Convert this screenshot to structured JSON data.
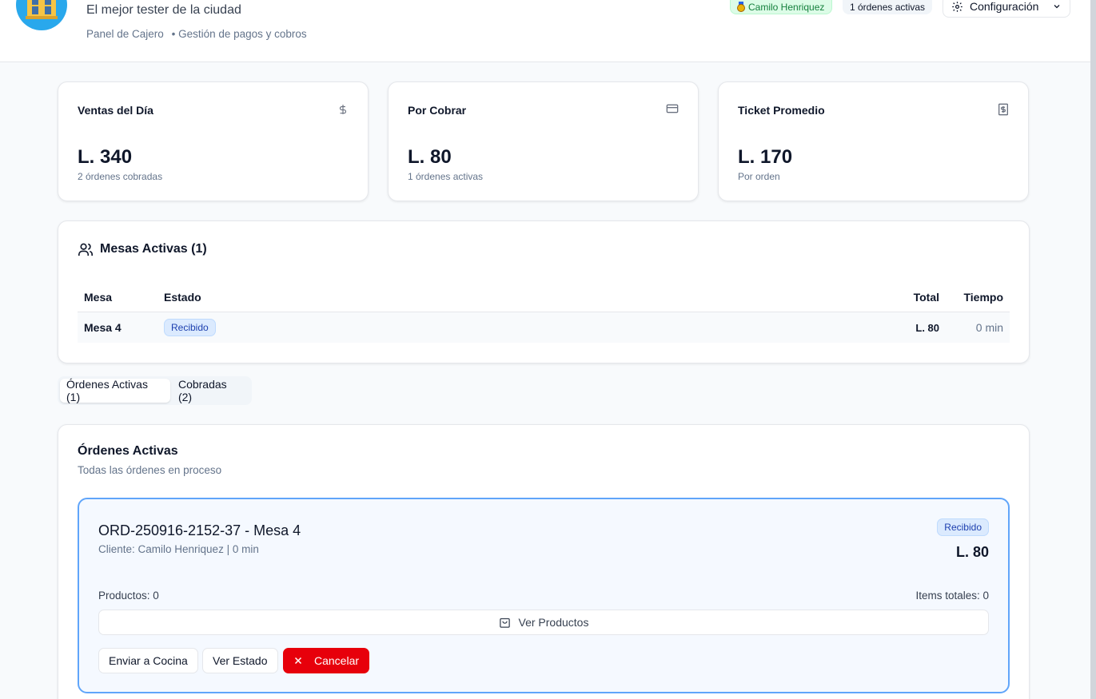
{
  "header": {
    "subtitle": "El mejor tester de la ciudad",
    "panel_label": "Panel de Cajero",
    "panel_desc": "• Gestión de pagos y cobros",
    "user_badge": "Camilo Henriquez",
    "active_badge": "1 órdenes activas",
    "config_label": "Configuración"
  },
  "stats": [
    {
      "title": "Ventas del Día",
      "value": "L. 340",
      "sub": "2 órdenes cobradas",
      "icon": "dollar-icon"
    },
    {
      "title": "Por Cobrar",
      "value": "L. 80",
      "sub": "1 órdenes activas",
      "icon": "credit-card-icon"
    },
    {
      "title": "Ticket Promedio",
      "value": "L. 170",
      "sub": "Por orden",
      "icon": "receipt-icon"
    }
  ],
  "mesas": {
    "title": "Mesas Activas (1)",
    "columns": {
      "mesa": "Mesa",
      "estado": "Estado",
      "total": "Total",
      "tiempo": "Tiempo"
    },
    "rows": [
      {
        "mesa": "Mesa 4",
        "estado": "Recibido",
        "total": "L. 80",
        "tiempo": "0 min"
      }
    ]
  },
  "tabs": [
    {
      "label": "Órdenes Activas (1)",
      "active": true
    },
    {
      "label": "Cobradas (2)",
      "active": false
    }
  ],
  "orders": {
    "title": "Órdenes Activas",
    "description": "Todas las órdenes en proceso",
    "items": [
      {
        "title": "ORD-250916-2152-37 - Mesa 4",
        "client": "Cliente: Camilo Henriquez | 0 min",
        "status": "Recibido",
        "total": "L. 80",
        "products": "Productos: 0",
        "items_total": "Items totales: 0",
        "view_label": "Ver Productos",
        "send_label": "Enviar a Cocina",
        "state_label": "Ver Estado",
        "cancel_label": "Cancelar"
      }
    ]
  },
  "colors": {
    "accent": "#60a5fa",
    "danger": "#e7000b",
    "success": "#15803d",
    "status_blue": "#1e40af"
  }
}
